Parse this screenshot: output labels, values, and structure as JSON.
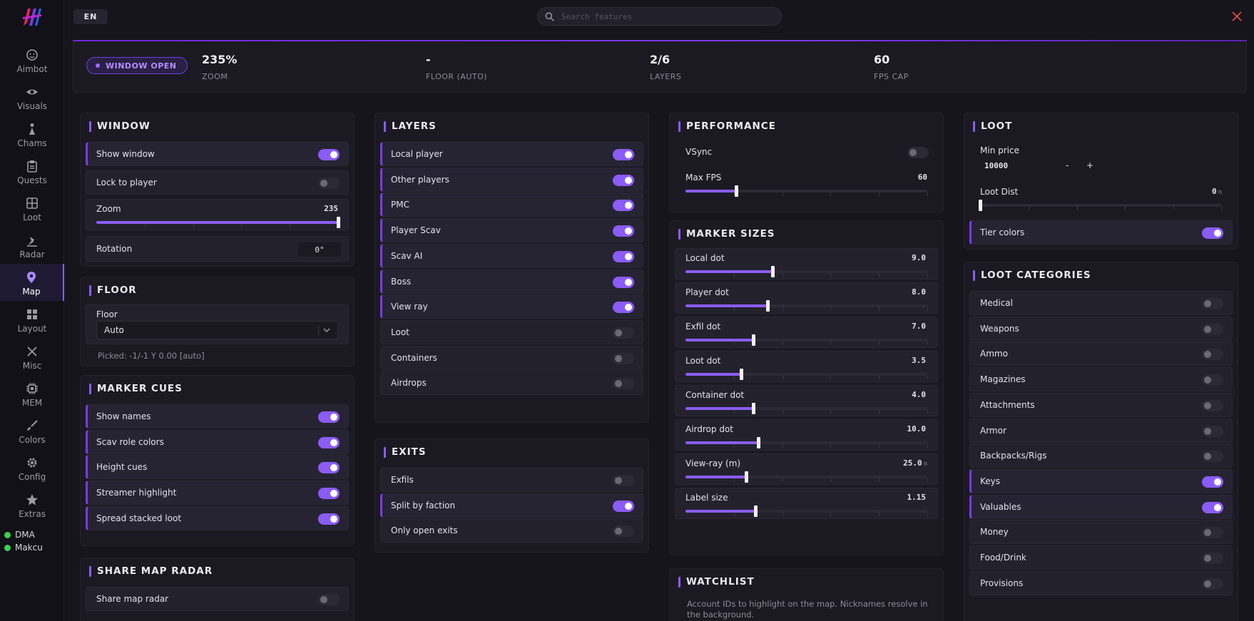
{
  "lang": "EN",
  "search": {
    "placeholder": "Search features"
  },
  "colors": {
    "accent": "#8b5cf6",
    "close": "#e04a4a",
    "online": "#3ccf4e"
  },
  "nav": [
    {
      "label": "Aimbot",
      "icon": "aimbot-icon"
    },
    {
      "label": "Visuals",
      "icon": "eye-icon"
    },
    {
      "label": "Chams",
      "icon": "chams-icon"
    },
    {
      "label": "Quests",
      "icon": "clipboard-icon"
    },
    {
      "label": "Loot",
      "icon": "grid-icon"
    },
    {
      "label": "Radar",
      "icon": "radar-icon"
    },
    {
      "label": "Map",
      "icon": "map-pin-icon"
    },
    {
      "label": "Layout",
      "icon": "layout-icon"
    },
    {
      "label": "Misc",
      "icon": "tools-icon"
    },
    {
      "label": "MEM",
      "icon": "chip-icon"
    },
    {
      "label": "Colors",
      "icon": "brush-icon"
    },
    {
      "label": "Config",
      "icon": "gear-icon"
    },
    {
      "label": "Extras",
      "icon": "star-icon"
    }
  ],
  "nav_active": 6,
  "status": [
    {
      "label": "DMA"
    },
    {
      "label": "Makcu"
    }
  ],
  "statbar": {
    "badge": "WINDOW OPEN",
    "stats": [
      {
        "value": "235%",
        "label": "ZOOM"
      },
      {
        "value": "-",
        "label": "FLOOR (AUTO)"
      },
      {
        "value": "2/6",
        "label": "LAYERS"
      },
      {
        "value": "60",
        "label": "FPS CAP"
      }
    ]
  },
  "window_panel": {
    "title": "WINDOW",
    "show_window": {
      "label": "Show window",
      "on": true
    },
    "lock_to_player": {
      "label": "Lock to player",
      "on": false
    },
    "zoom": {
      "label": "Zoom",
      "value": "235",
      "fraction": 1.0
    },
    "rotation": {
      "label": "Rotation",
      "value": "0°"
    }
  },
  "floor_panel": {
    "title": "FLOOR",
    "label": "Floor",
    "selected": "Auto",
    "picked": "Picked: -1/-1  Y 0.00  [auto]"
  },
  "marker_cues": {
    "title": "MARKER CUES",
    "items": [
      {
        "label": "Show names",
        "on": true
      },
      {
        "label": "Scav role colors",
        "on": true
      },
      {
        "label": "Height cues",
        "on": true
      },
      {
        "label": "Streamer highlight",
        "on": true
      },
      {
        "label": "Spread stacked loot",
        "on": true
      }
    ]
  },
  "share_map": {
    "title": "SHARE MAP RADAR",
    "items": [
      {
        "label": "Share map radar",
        "on": false
      }
    ]
  },
  "layers": {
    "title": "LAYERS",
    "items": [
      {
        "label": "Local player",
        "on": true
      },
      {
        "label": "Other players",
        "on": true
      },
      {
        "label": "PMC",
        "on": true
      },
      {
        "label": "Player Scav",
        "on": true
      },
      {
        "label": "Scav AI",
        "on": true
      },
      {
        "label": "Boss",
        "on": true
      },
      {
        "label": "View ray",
        "on": true
      },
      {
        "label": "Loot",
        "on": false
      },
      {
        "label": "Containers",
        "on": false
      },
      {
        "label": "Airdrops",
        "on": false
      }
    ]
  },
  "exits": {
    "title": "EXITS",
    "items": [
      {
        "label": "Exfils",
        "on": false
      },
      {
        "label": "Split by faction",
        "on": true
      },
      {
        "label": "Only open exits",
        "on": false
      }
    ]
  },
  "performance": {
    "title": "PERFORMANCE",
    "vsync": {
      "label": "VSync",
      "on": false
    },
    "max_fps": {
      "label": "Max FPS",
      "value": "60",
      "fraction": 0.21
    }
  },
  "marker_sizes": {
    "title": "MARKER SIZES",
    "items": [
      {
        "label": "Local dot",
        "value": "9.0",
        "unit": "",
        "fraction": 0.36
      },
      {
        "label": "Player dot",
        "value": "8.0",
        "unit": "",
        "fraction": 0.34
      },
      {
        "label": "Exfil dot",
        "value": "7.0",
        "unit": "",
        "fraction": 0.28
      },
      {
        "label": "Loot dot",
        "value": "3.5",
        "unit": "",
        "fraction": 0.23
      },
      {
        "label": "Container dot",
        "value": "4.0",
        "unit": "",
        "fraction": 0.28
      },
      {
        "label": "Airdrop dot",
        "value": "10.0",
        "unit": "",
        "fraction": 0.3
      },
      {
        "label": "View-ray (m)",
        "value": "25.0",
        "unit": "m",
        "fraction": 0.25
      },
      {
        "label": "Label size",
        "value": "1.15",
        "unit": "",
        "fraction": 0.29
      }
    ]
  },
  "watchlist": {
    "title": "WATCHLIST",
    "desc": "Account IDs to highlight on the map. Nicknames resolve in the background."
  },
  "loot": {
    "title": "LOOT",
    "min_price": {
      "label": "Min price",
      "value": "10000",
      "minus": "-",
      "plus": "+"
    },
    "loot_dist": {
      "label": "Loot Dist",
      "value": "0",
      "unit": "m",
      "fraction": 0.0
    },
    "tier_colors": {
      "label": "Tier colors",
      "on": true
    }
  },
  "loot_categories": {
    "title": "LOOT CATEGORIES",
    "items": [
      {
        "label": "Medical",
        "on": false
      },
      {
        "label": "Weapons",
        "on": false
      },
      {
        "label": "Ammo",
        "on": false
      },
      {
        "label": "Magazines",
        "on": false
      },
      {
        "label": "Attachments",
        "on": false
      },
      {
        "label": "Armor",
        "on": false
      },
      {
        "label": "Backpacks/Rigs",
        "on": false
      },
      {
        "label": "Keys",
        "on": true
      },
      {
        "label": "Valuables",
        "on": true
      },
      {
        "label": "Money",
        "on": false
      },
      {
        "label": "Food/Drink",
        "on": false
      },
      {
        "label": "Provisions",
        "on": false
      }
    ]
  }
}
